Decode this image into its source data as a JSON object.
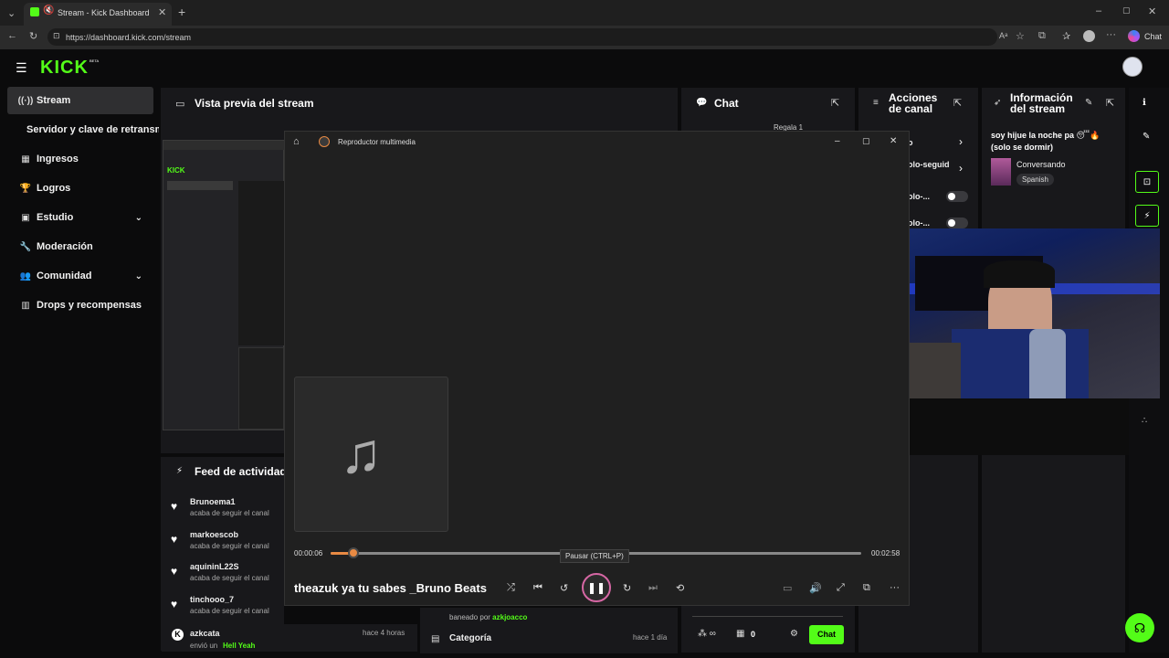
{
  "browser": {
    "tab_title": "Stream - Kick Dashboard",
    "url": "https://dashboard.kick.com/stream",
    "chat_label": "Chat"
  },
  "app": {
    "logo": "KICK",
    "beta": "BETA"
  },
  "sidebar": {
    "items": [
      {
        "label": "Stream"
      },
      {
        "label": "Servidor y clave de retransmisión"
      },
      {
        "label": "Ingresos"
      },
      {
        "label": "Logros"
      },
      {
        "label": "Estudio"
      },
      {
        "label": "Moderación"
      },
      {
        "label": "Comunidad"
      },
      {
        "label": "Drops y recompensas"
      }
    ]
  },
  "panels": {
    "preview_title": "Vista previa del stream",
    "chat_title": "Chat",
    "chat_gift": "Regala 1",
    "actions_title_1": "Acciones",
    "actions_title_2": "de canal",
    "action_rows": [
      "o",
      "olo-seguid",
      "olo-...",
      "olo-..."
    ],
    "info_title_1": "Información",
    "info_title_2": "del stream",
    "stream_title": "soy hijue la noche pa 😴🔥 (solo se dormir)",
    "category": "Conversando",
    "language": "Spanish",
    "feed_title": "Feed de actividad",
    "mod_banned_prefix": "baneado por",
    "mod_banned_user": "azkjoacco",
    "category_label": "Categoría",
    "category_time": "hace 1 día",
    "chat_count": "0",
    "chat_button": "Chat"
  },
  "feed": [
    {
      "name": "Brunoema1",
      "sub": "acaba de seguir el canal"
    },
    {
      "name": "markoescob",
      "sub": "acaba de seguir el canal"
    },
    {
      "name": "aquininL22S",
      "sub": "acaba de seguir el canal"
    },
    {
      "name": "tinchooo_7",
      "sub": "acaba de seguir el canal"
    },
    {
      "name": "azkcata",
      "sub": "envió un",
      "extra": "Hell Yeah",
      "time": "hace 4 horas"
    }
  ],
  "player": {
    "app_title": "Reproductor multimedia",
    "time_current": "00:00:06",
    "time_total": "00:02:58",
    "progress": 0.034,
    "tooltip": "Pausar (CTRL+P)",
    "track_title": "theazuk ya tu sabes _Bruno Beats"
  }
}
